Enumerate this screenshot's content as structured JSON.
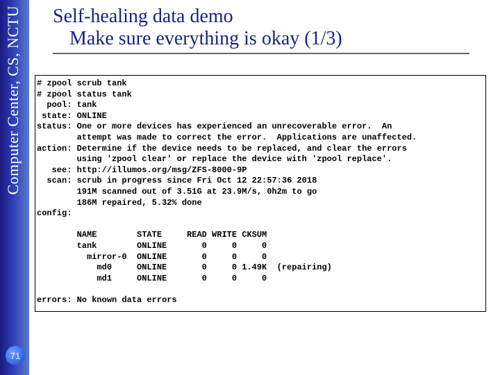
{
  "sidebar": {
    "label": "Computer Center, CS, NCTU"
  },
  "title": {
    "line1": "Self-healing data demo",
    "line2": "Make sure everything is okay (1/3)"
  },
  "terminal": {
    "cmd1": "# zpool scrub tank",
    "cmd2": "# zpool status tank",
    "pool_label": "  pool:",
    "pool_value": "tank",
    "state_label": " state:",
    "state_value": "ONLINE",
    "status_label": "status:",
    "status_l1": "One or more devices has experienced an unrecoverable error.  An",
    "status_l2": "        attempt was made to correct the error.  Applications are unaffected.",
    "action_label": "action:",
    "action_l1": "Determine if the device needs to be replaced, and clear the errors",
    "action_l2": "        using 'zpool clear' or replace the device with 'zpool replace'.",
    "see_label": "   see:",
    "see_value": "http://illumos.org/msg/ZFS-8000-9P",
    "scan_label": "  scan:",
    "scan_l1": "scrub in progress since Fri Oct 12 22:57:36 2018",
    "scan_l2": "        191M scanned out of 3.51G at 23.9M/s, 0h2m to go",
    "scan_l3": "        186M repaired, 5.32% done",
    "config_label": "config:",
    "table_header": "        NAME        STATE     READ WRITE CKSUM",
    "table_r1": "        tank        ONLINE       0     0     0",
    "table_r2": "          mirror-0  ONLINE       0     0     0",
    "table_r3": "            md0     ONLINE       0     0 1.49K  (repairing)",
    "table_r4": "            md1     ONLINE       0     0     0",
    "errors_line": "errors: No known data errors"
  },
  "page_number": "71"
}
